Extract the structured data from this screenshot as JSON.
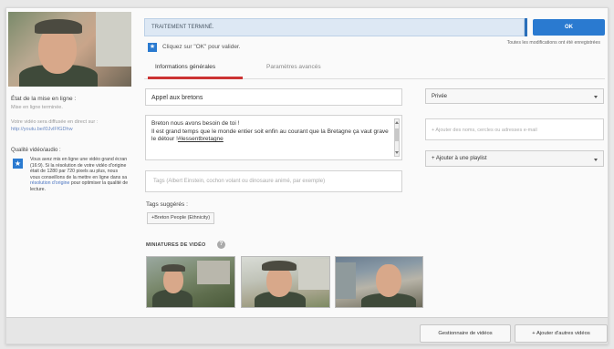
{
  "left": {
    "status_label": "État de la mise en ligne :",
    "status_value": "Mise en ligne terminée.",
    "url_label": "Votre vidéo sera diffusée en direct sur :",
    "url_link": "http://youtu.be/l0JvlFfGDhw",
    "quality_title": "Qualité vidéo/audio :",
    "quality_text_1": "Vous avez mis en ligne une vidéo grand écran (16:9). Si la résolution de votre vidéo d'origine était de 1280 par 720 pixels au plus, nous vous conseillons de la mettre en ligne dans sa",
    "quality_link": "résolution d'origine",
    "quality_text_2": "pour optimiser la qualité de lecture."
  },
  "topbar": {
    "message": "TRAITEMENT TERMINÉ.",
    "ok_label": "OK",
    "ok_note": "Toutes les modifications ont été enregistrées",
    "info_text": "Cliquez sur \"OK\" pour valider."
  },
  "tabs": {
    "general": "Informations générales",
    "advanced": "Paramètres avancés"
  },
  "form": {
    "title_value": "Appel aux bretons",
    "desc_line1": "Breton nous avons besoin de toi !",
    "desc_line2": "Il est grand temps que le monde entier soit enfin au courant que la Bretagne ça vaut grave le détour !",
    "desc_hashtag": "#lessentbretagne",
    "tags_placeholder": "Tags (Albert Einstein, cochon volant ou dinosaure animé, par exemple)",
    "suggested_label": "Tags suggérés :",
    "suggested_tags": [
      "+Breton People (Ethnicity)"
    ]
  },
  "right": {
    "privacy_value": "Privée",
    "share_placeholder": "+ Ajouter des noms, cercles ou adresses e-mail",
    "playlist_label": "+ Ajouter à une playlist"
  },
  "thumbnails": {
    "label": "MINIATURES DE VIDÉO",
    "help": "?"
  },
  "footer": {
    "manager_label": "Gestionnaire de vidéos",
    "add_label": "+ Ajouter d'autres vidéos"
  },
  "colors": {
    "accent_blue": "#2a7ad0",
    "tab_red": "#cc3333"
  }
}
